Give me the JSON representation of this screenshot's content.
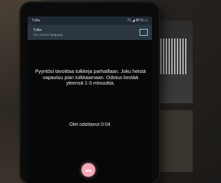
{
  "status_bar": {
    "app_name": "Tulka",
    "right_text": "71 ◢ 88 % ▭"
  },
  "notification": {
    "title": "Tulka",
    "subtitle": "The chosen language"
  },
  "call_message": "Pyyntösi tavoittaa tulkkeja parhaillaan. Joku heistä vapautuu pian tulkkaamaan. Odotus kestää yleensä 1-3 minuuttia.",
  "waited_text": "Olet odottanut 0:04",
  "icons": {
    "end_call": "phone-icon",
    "notification_square": "square-icon"
  },
  "colors": {
    "end_call_button": "#f4a7b7",
    "notification_accent": "#7fd6ff"
  }
}
